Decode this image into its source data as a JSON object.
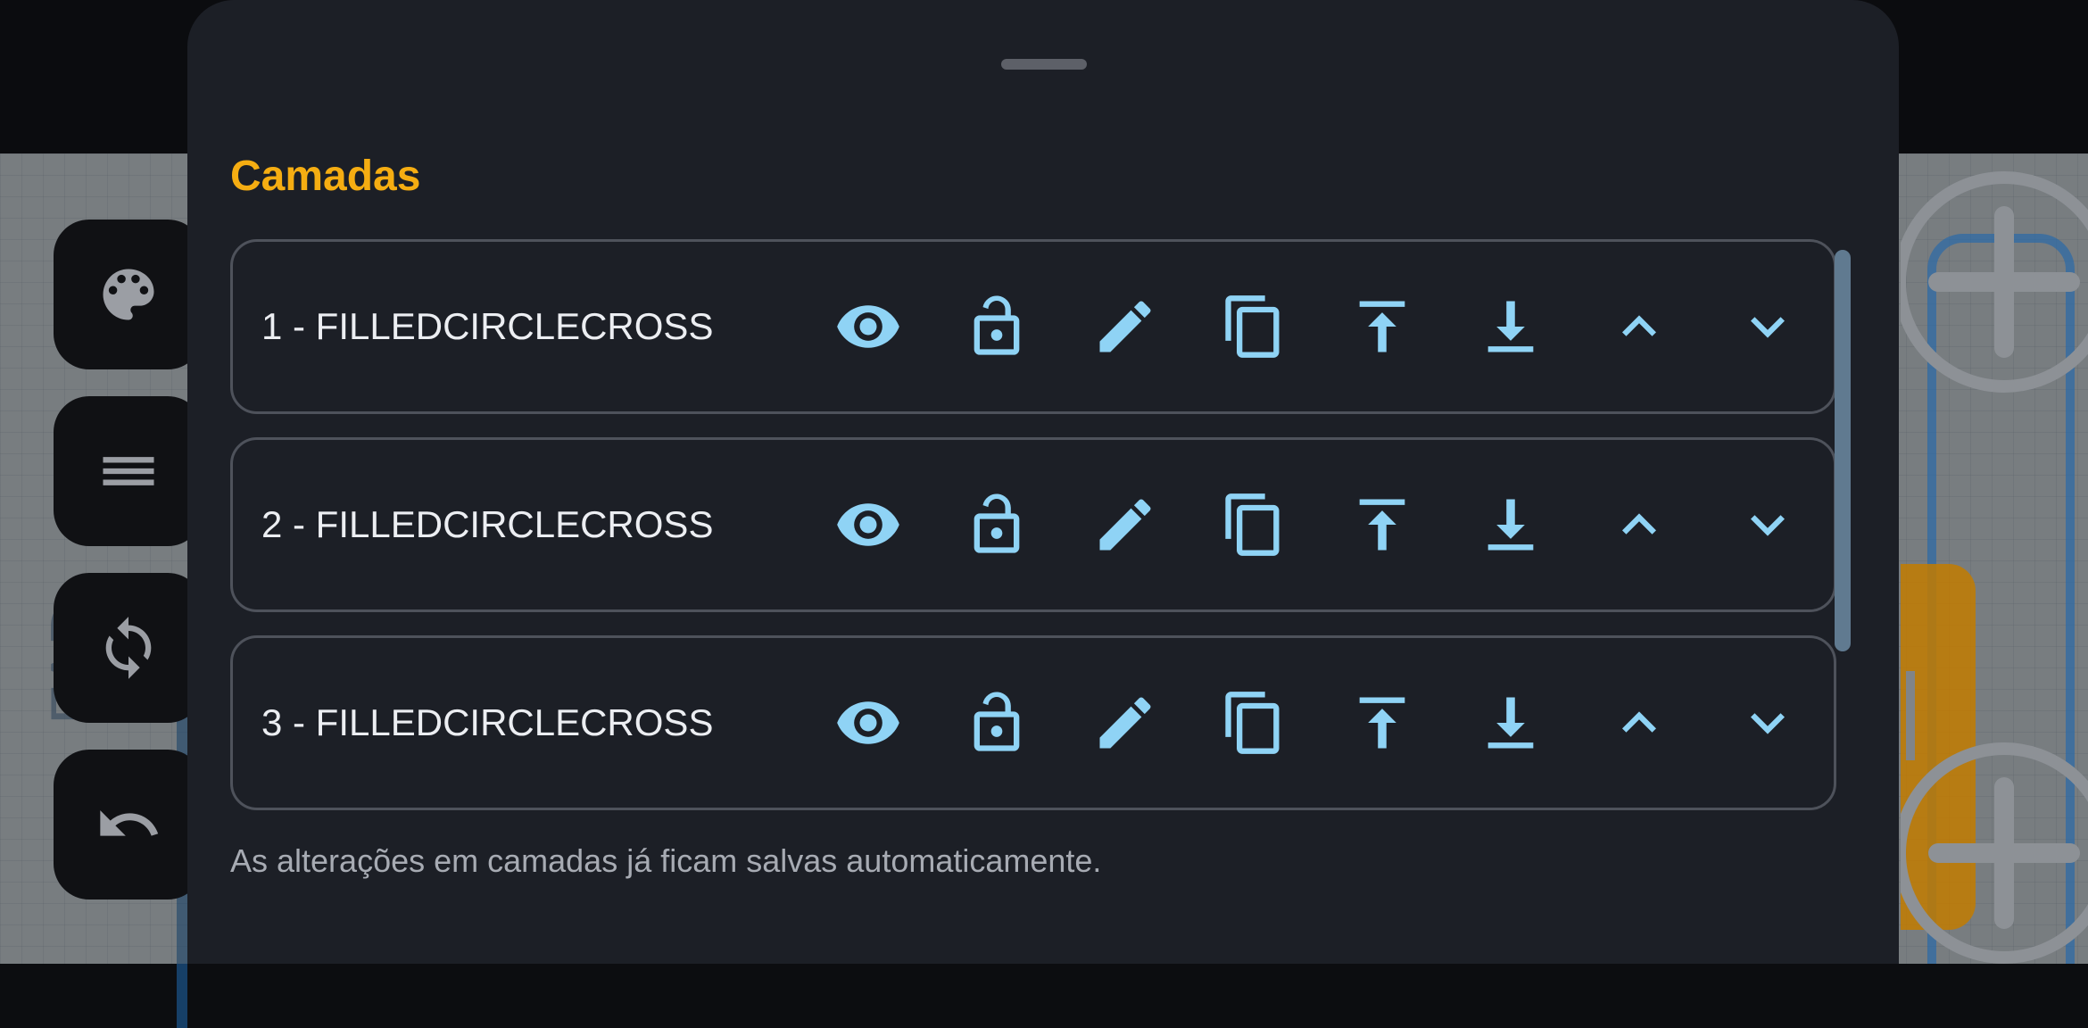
{
  "panel": {
    "title": "Camadas",
    "footer_note": "As alterações em camadas já ficam salvas automaticamente."
  },
  "layers": [
    {
      "label": "1 - FILLEDCIRCLECROSS"
    },
    {
      "label": "2 - FILLEDCIRCLECROSS"
    },
    {
      "label": "3 - FILLEDCIRCLECROSS"
    }
  ],
  "layer_actions": [
    "visibility-icon",
    "lock-open-icon",
    "edit-icon",
    "duplicate-icon",
    "move-to-top-icon",
    "move-to-bottom-icon",
    "move-up-icon",
    "move-down-icon"
  ],
  "side_toolbar": [
    "palette-icon",
    "menu-icon",
    "sync-icon",
    "undo-icon"
  ],
  "canvas": {
    "text": "FAD"
  },
  "colors": {
    "accent": "#f5ad12",
    "icon": "#8fd3f5",
    "sheet_background": "#1c1f26",
    "row_border": "#4e525b",
    "text": "#eceef2",
    "muted_text": "#a7abb3"
  }
}
